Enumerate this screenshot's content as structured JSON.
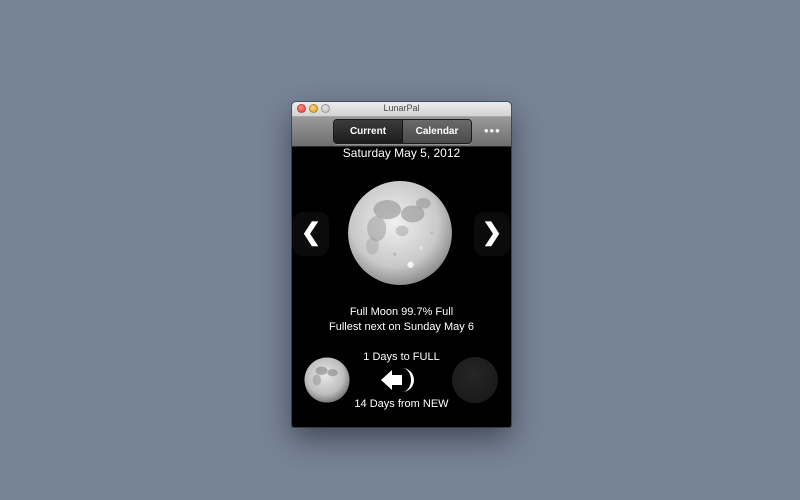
{
  "window": {
    "title": "LunarPal"
  },
  "toolbar": {
    "segments": [
      "Current",
      "Calendar"
    ],
    "more_icon": "ellipsis-icon"
  },
  "main": {
    "date": "Saturday May 5, 2012",
    "prev_glyph": "❮",
    "next_glyph": "❯",
    "phase": "Full Moon 99.7% Full",
    "fullest": "Fullest next on Sunday May 6",
    "days_to_full": "1 Days to FULL",
    "days_from_new": "14 Days from NEW"
  },
  "colors": {
    "desktop": "#778397",
    "window_bg": "#000000",
    "text": "#ffffff"
  }
}
